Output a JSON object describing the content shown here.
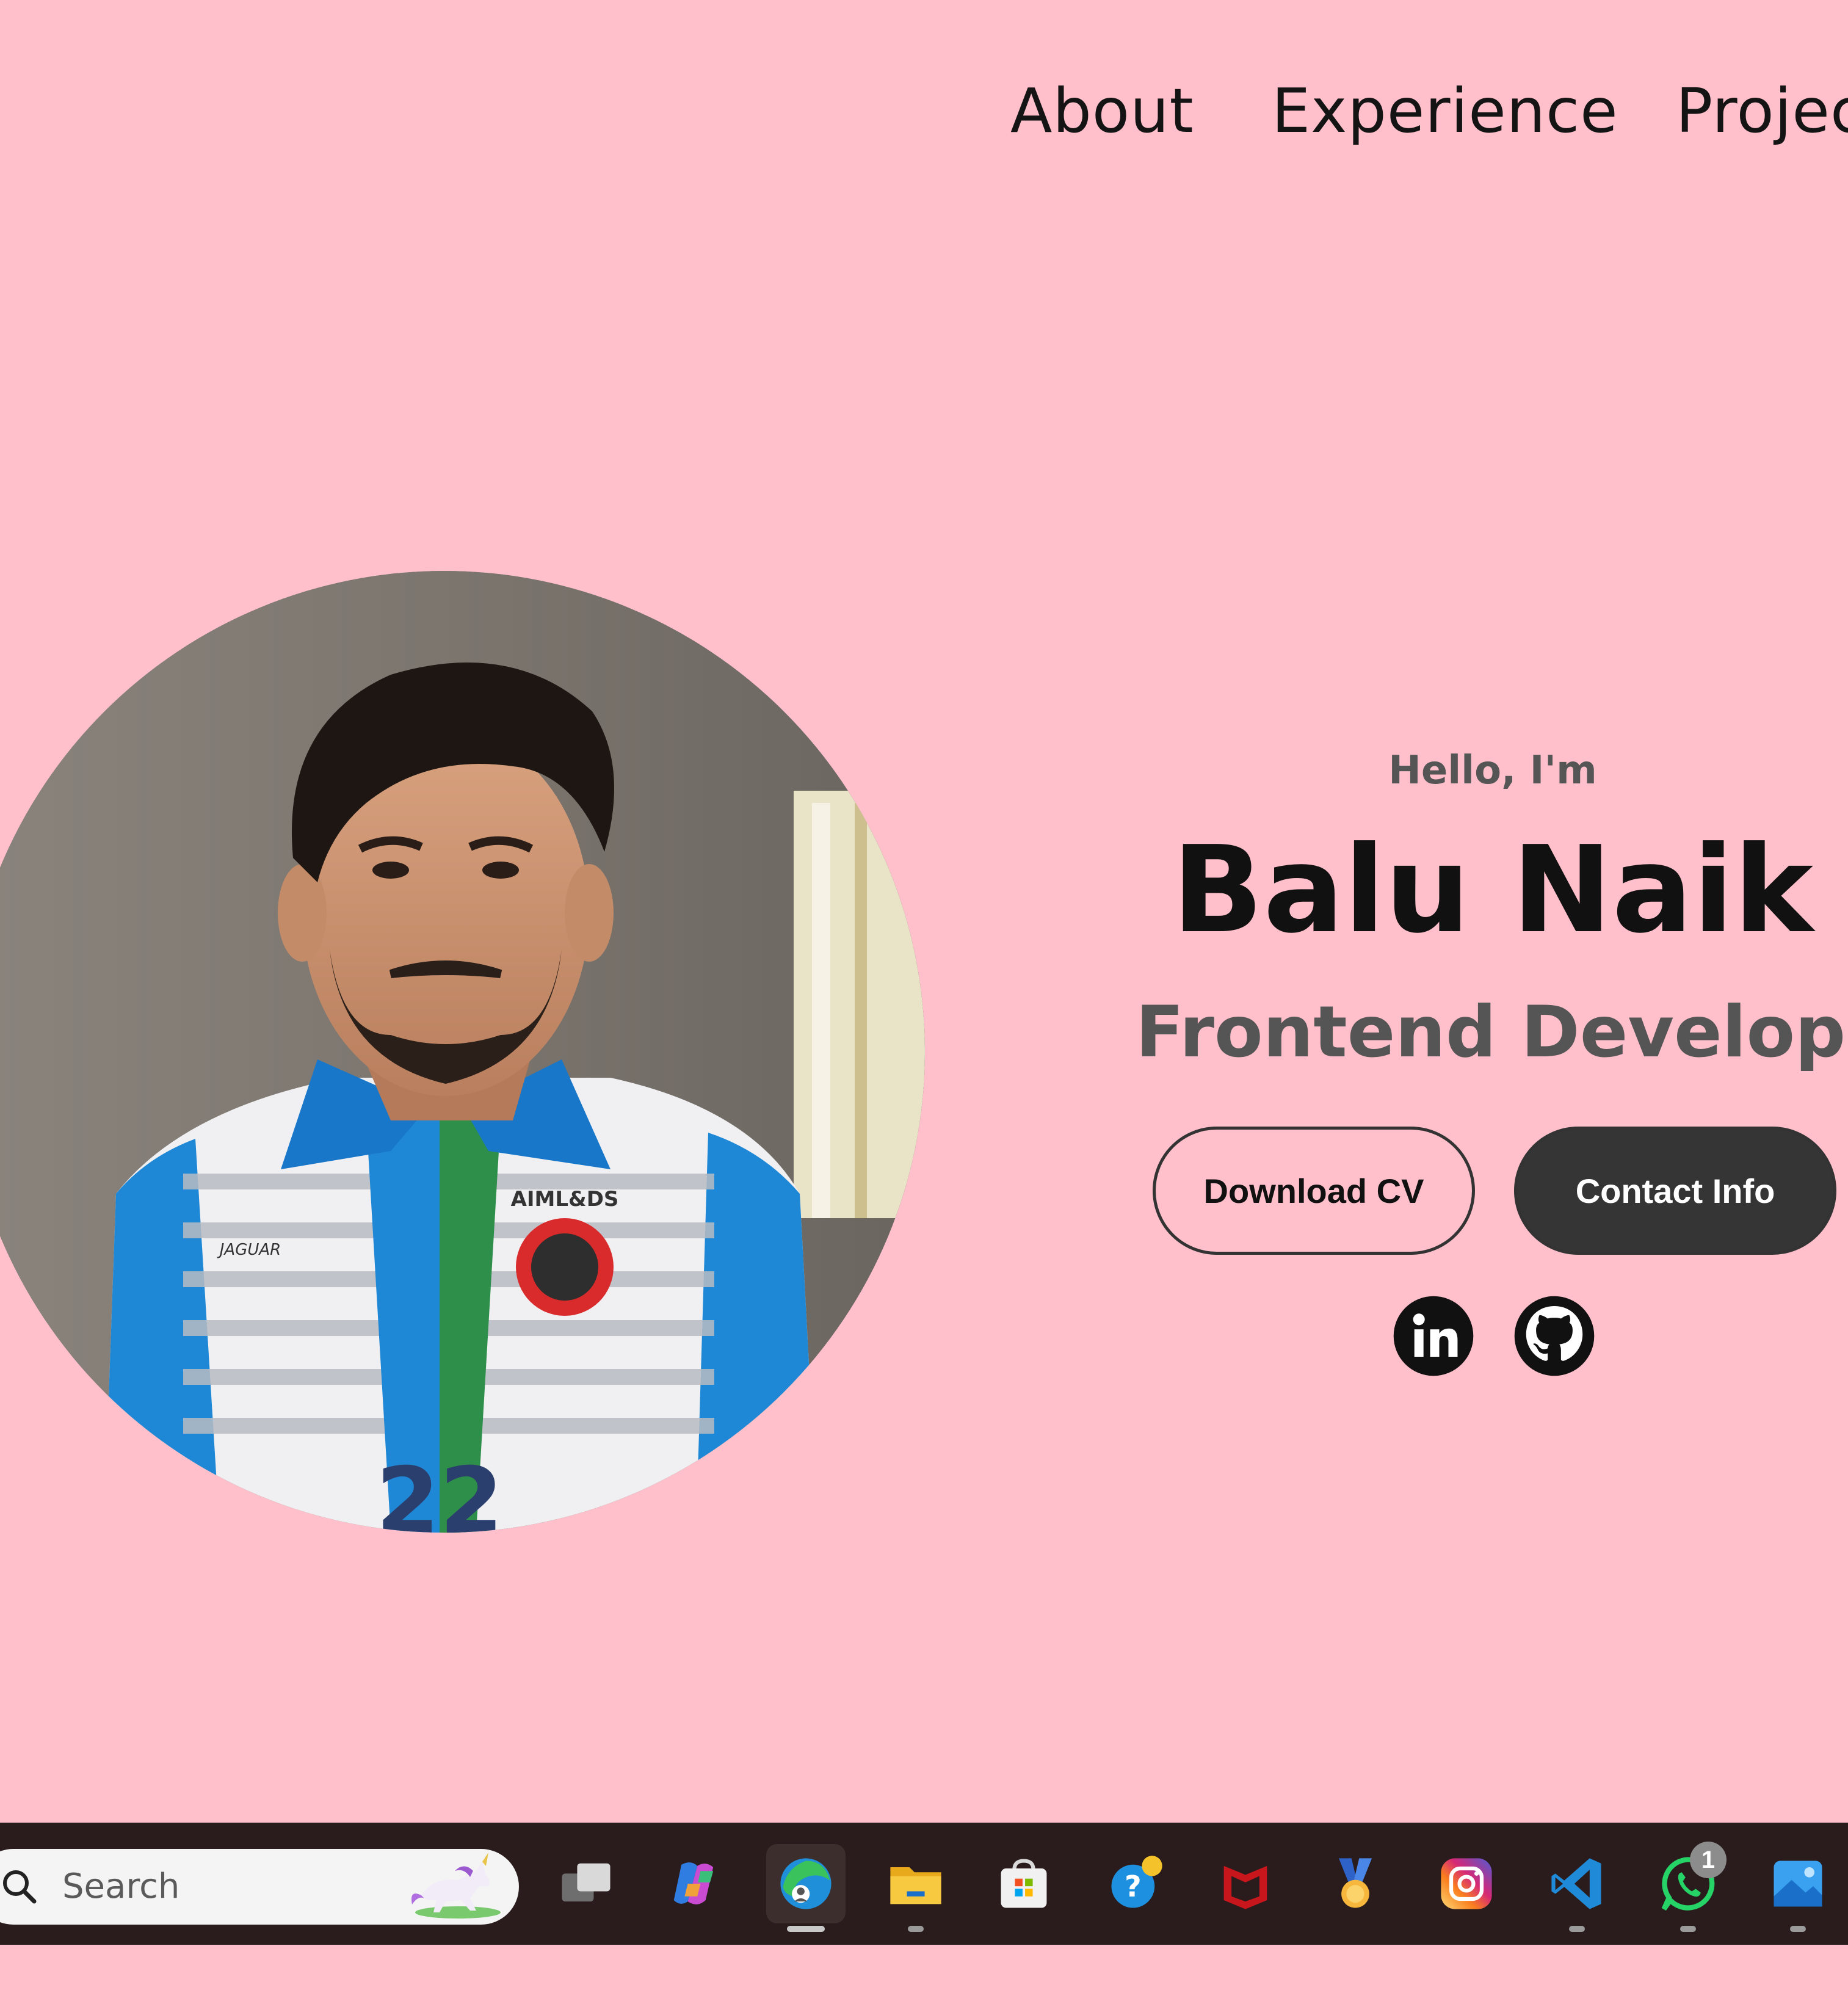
{
  "nav": {
    "about": "About",
    "experience": "Experience",
    "projects": "Projec"
  },
  "hero": {
    "greeting": "Hello, I'm",
    "name": "Balu Naik",
    "title": "Frontend Developer",
    "download_cv": "Download CV",
    "contact_info": "Contact Info",
    "photo_jersey_text": "AIML&DS",
    "photo_jersey_brand": "JAGUAR",
    "photo_jersey_number": "22"
  },
  "social": {
    "linkedin_icon": "linkedin-icon",
    "github_icon": "github-icon"
  },
  "taskbar": {
    "search_placeholder": "Search",
    "whatsapp_badge": "1",
    "apps": [
      "task-view",
      "copilot",
      "edge",
      "file-explorer",
      "microsoft-store",
      "get-help",
      "mcafee",
      "medal",
      "instagram",
      "vscode",
      "whatsapp",
      "photos"
    ]
  },
  "colors": {
    "background": "#ffc0cb",
    "primary_text": "#111111",
    "secondary_text": "#555555",
    "button_dark": "#353535",
    "taskbar": "#2a1c1c"
  }
}
